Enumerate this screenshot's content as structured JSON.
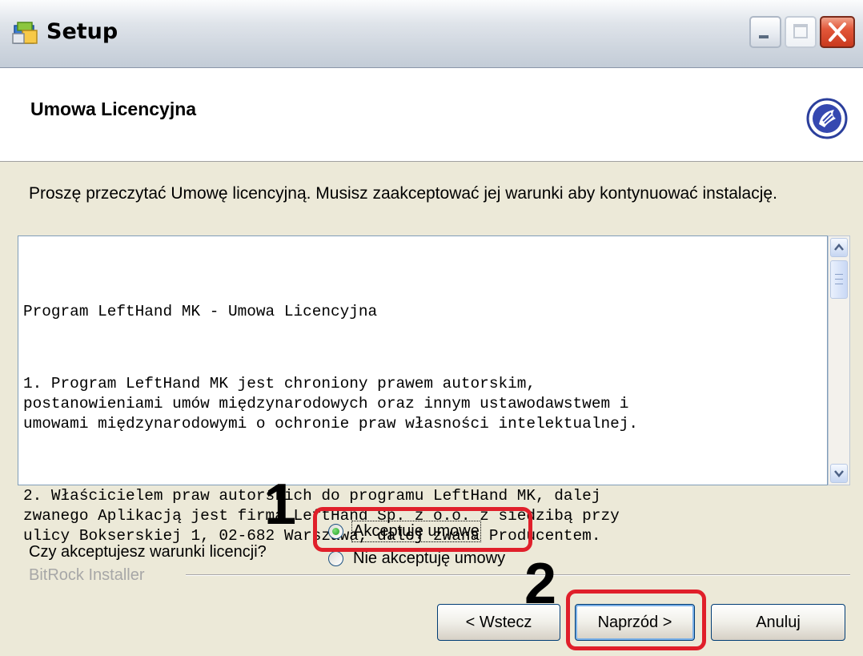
{
  "window": {
    "title": "Setup",
    "controls": [
      "minimize",
      "maximize",
      "close"
    ]
  },
  "header": {
    "title": "Umowa Licencyjna",
    "logo_icon": "bitrock-hand-icon"
  },
  "instruction": "Proszę przeczytać Umowę licencyjną. Musisz zaakceptować jej warunki aby kontynuować instalację.",
  "license": {
    "paragraphs": [
      [
        "Program LeftHand MK - Umowa Licencyjna"
      ],
      [
        "1. Program LeftHand MK jest chroniony prawem autorskim,",
        "postanowieniami umów międzynarodowych oraz innym ustawodawstwem i",
        "umowami międzynarodowymi o ochronie praw własności intelektualnej."
      ],
      [
        "2. Właścicielem praw autorskich do programu LeftHand MK, dalej",
        "zwanego Aplikacją jest firma LeftHand Sp. z o.o. z siedzibą przy",
        "ulicy Bokserskiej 1, 02-682 Warszawa, dalej zwana Producentem."
      ]
    ]
  },
  "question": "Czy akceptujesz warunki licencji?",
  "options": {
    "accept": {
      "label": "Akceptuję umowę",
      "selected": true
    },
    "decline": {
      "label": "Nie akceptuję umowy",
      "selected": false
    }
  },
  "annotations": {
    "step1": "1",
    "step2": "2",
    "color": "#e01f2a"
  },
  "footer": {
    "installer_label": "BitRock Installer"
  },
  "buttons": {
    "back": "< Wstecz",
    "next": "Naprzód >",
    "cancel": "Anuluj"
  }
}
